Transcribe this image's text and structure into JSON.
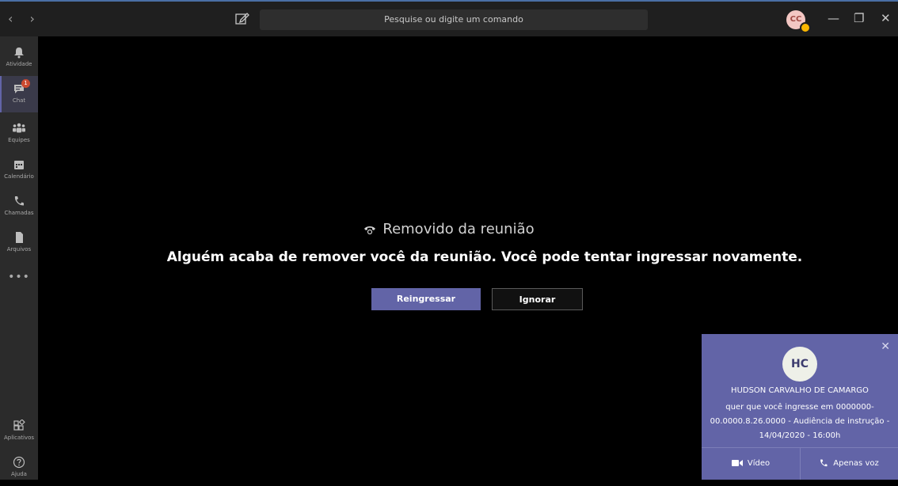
{
  "search": {
    "placeholder": "Pesquise ou digite um comando"
  },
  "user": {
    "initials": "CC"
  },
  "window": {
    "minimize": "—",
    "restore": "❐",
    "close": "✕"
  },
  "nav": {
    "back": "‹",
    "forward": "›"
  },
  "rail": {
    "items": [
      {
        "label": "Atividade",
        "icon": "bell-icon"
      },
      {
        "label": "Chat",
        "icon": "chat-icon",
        "badge": "1",
        "active": true
      },
      {
        "label": "Equipes",
        "icon": "teams-icon"
      },
      {
        "label": "Calendário",
        "icon": "calendar-icon"
      },
      {
        "label": "Chamadas",
        "icon": "phone-icon"
      },
      {
        "label": "Arquivos",
        "icon": "file-icon"
      }
    ],
    "more": "•••",
    "bottom": [
      {
        "label": "Aplicativos",
        "icon": "apps-icon"
      },
      {
        "label": "Ajuda",
        "icon": "help-icon"
      }
    ]
  },
  "main": {
    "title": "Removido da reunião",
    "message": "Alguém acaba de remover você da reunião. Você pode tentar ingressar novamente.",
    "rejoin_label": "Reingressar",
    "ignore_label": "Ignorar"
  },
  "toast": {
    "initials": "HC",
    "caller": "HUDSON CARVALHO DE CAMARGO",
    "line1": "quer que você ingresse em 0000000-",
    "line2": "00.0000.8.26.0000 - Audiência de instrução -",
    "line3": "14/04/2020 - 16:00h",
    "video_label": "Vídeo",
    "voice_label": "Apenas voz",
    "close": "✕"
  },
  "colors": {
    "accent": "#6264a7",
    "badge": "#cc4a31",
    "status": "#fbb700"
  }
}
